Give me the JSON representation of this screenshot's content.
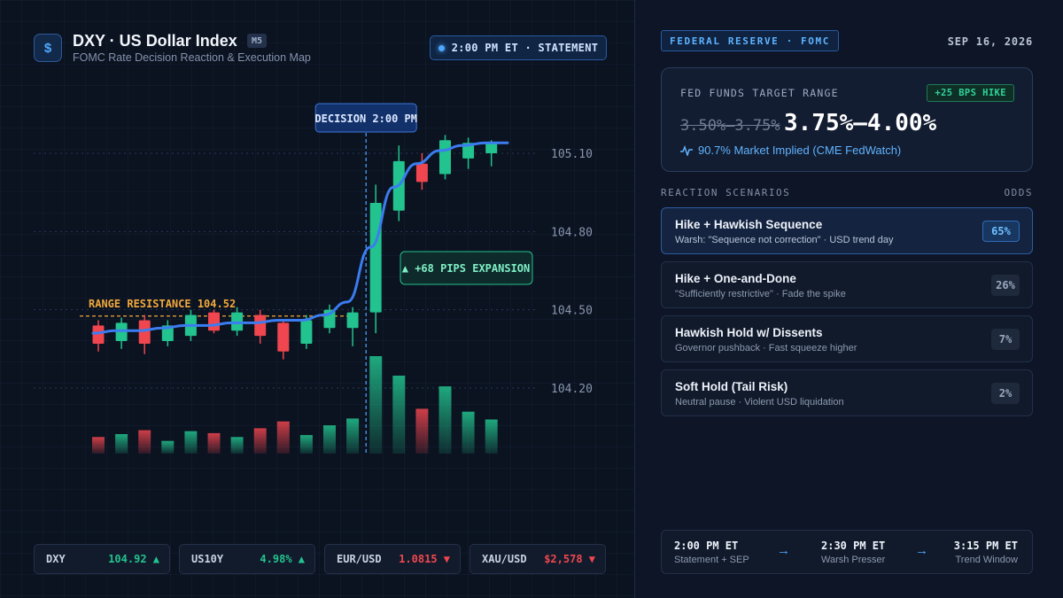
{
  "header": {
    "logo_glyph": "$",
    "title": "DXY · US Dollar Index",
    "timeframe": "M5",
    "subtitle": "FOMC Rate Decision Reaction & Execution Map",
    "statement_pill": "2:00 PM ET · STATEMENT"
  },
  "chart_data": {
    "type": "candlestick",
    "y_ticks": [
      "105.10",
      "104.80",
      "104.50",
      "104.20"
    ],
    "ylim": [
      104.0,
      105.22
    ],
    "candles": [
      {
        "o": 104.44,
        "h": 104.46,
        "l": 104.34,
        "c": 104.37,
        "vol": 0.17
      },
      {
        "o": 104.38,
        "h": 104.47,
        "l": 104.35,
        "c": 104.45,
        "vol": 0.2
      },
      {
        "o": 104.46,
        "h": 104.48,
        "l": 104.33,
        "c": 104.37,
        "vol": 0.24
      },
      {
        "o": 104.38,
        "h": 104.46,
        "l": 104.36,
        "c": 104.44,
        "vol": 0.13
      },
      {
        "o": 104.4,
        "h": 104.5,
        "l": 104.38,
        "c": 104.48,
        "vol": 0.23
      },
      {
        "o": 104.49,
        "h": 104.5,
        "l": 104.41,
        "c": 104.42,
        "vol": 0.21
      },
      {
        "o": 104.42,
        "h": 104.51,
        "l": 104.4,
        "c": 104.49,
        "vol": 0.17
      },
      {
        "o": 104.48,
        "h": 104.5,
        "l": 104.37,
        "c": 104.4,
        "vol": 0.26
      },
      {
        "o": 104.45,
        "h": 104.46,
        "l": 104.31,
        "c": 104.34,
        "vol": 0.33
      },
      {
        "o": 104.37,
        "h": 104.48,
        "l": 104.35,
        "c": 104.46,
        "vol": 0.19
      },
      {
        "o": 104.43,
        "h": 104.52,
        "l": 104.41,
        "c": 104.5,
        "vol": 0.29
      },
      {
        "o": 104.43,
        "h": 104.51,
        "l": 104.36,
        "c": 104.49,
        "vol": 0.36
      },
      {
        "o": 104.49,
        "h": 104.98,
        "l": 104.41,
        "c": 104.91,
        "vol": 1.0
      },
      {
        "o": 104.88,
        "h": 105.13,
        "l": 104.84,
        "c": 105.07,
        "vol": 0.8
      },
      {
        "o": 105.06,
        "h": 105.1,
        "l": 104.96,
        "c": 104.99,
        "vol": 0.46
      },
      {
        "o": 105.02,
        "h": 105.17,
        "l": 105.0,
        "c": 105.15,
        "vol": 0.69
      },
      {
        "o": 105.08,
        "h": 105.16,
        "l": 105.04,
        "c": 105.14,
        "vol": 0.43
      },
      {
        "o": 105.1,
        "h": 105.15,
        "l": 105.05,
        "c": 105.14,
        "vol": 0.35
      }
    ],
    "moving_average": [
      104.41,
      104.42,
      104.42,
      104.43,
      104.44,
      104.44,
      104.45,
      104.45,
      104.46,
      104.46,
      104.48,
      104.53,
      104.74,
      104.97,
      105.06,
      105.11,
      105.13,
      105.14
    ],
    "resistance": {
      "value": 104.52,
      "label": "RANGE RESISTANCE 104.52"
    },
    "decision_label": "DECISION 2:00 PM",
    "decision_index": 12,
    "expansion_label": "▲ +68 PIPS EXPANSION"
  },
  "tickers": [
    {
      "symbol": "DXY",
      "value": "104.92 ▲",
      "dir": "up"
    },
    {
      "symbol": "US10Y",
      "value": "4.98% ▲",
      "dir": "up"
    },
    {
      "symbol": "EUR/USD",
      "value": "1.0815 ▼",
      "dir": "down"
    },
    {
      "symbol": "XAU/USD",
      "value": "$2,578 ▼",
      "dir": "down"
    }
  ],
  "panel": {
    "tag": "FEDERAL RESERVE · FOMC",
    "date": "SEP 16, 2026",
    "rate": {
      "label": "FED FUNDS TARGET RANGE",
      "badge": "+25 BPS HIKE",
      "old": "3.50%–3.75%",
      "new": "3.75%–4.00%",
      "implied": "90.7% Market Implied (CME FedWatch)"
    },
    "scenarios_heading": "REACTION SCENARIOS",
    "odds_heading": "ODDS",
    "scenarios": [
      {
        "title": "Hike + Hawkish Sequence",
        "sub": "Warsh: \"Sequence not correction\" · USD trend day",
        "odds": "65%"
      },
      {
        "title": "Hike + One-and-Done",
        "sub": "\"Sufficiently restrictive\" · Fade the spike",
        "odds": "26%"
      },
      {
        "title": "Hawkish Hold w/ Dissents",
        "sub": "Governor pushback · Fast squeeze higher",
        "odds": "7%"
      },
      {
        "title": "Soft Hold (Tail Risk)",
        "sub": "Neutral pause · Violent USD liquidation",
        "odds": "2%"
      }
    ],
    "timeline": [
      {
        "time": "2:00 PM ET",
        "label": "Statement + SEP"
      },
      {
        "time": "2:30 PM ET",
        "label": "Warsh Presser"
      },
      {
        "time": "3:15 PM ET",
        "label": "Trend Window"
      }
    ],
    "colors": {
      "up": "#22c38e",
      "down": "#f0464f",
      "accent": "#4ea8ff",
      "resistance": "#f2a93b"
    }
  }
}
